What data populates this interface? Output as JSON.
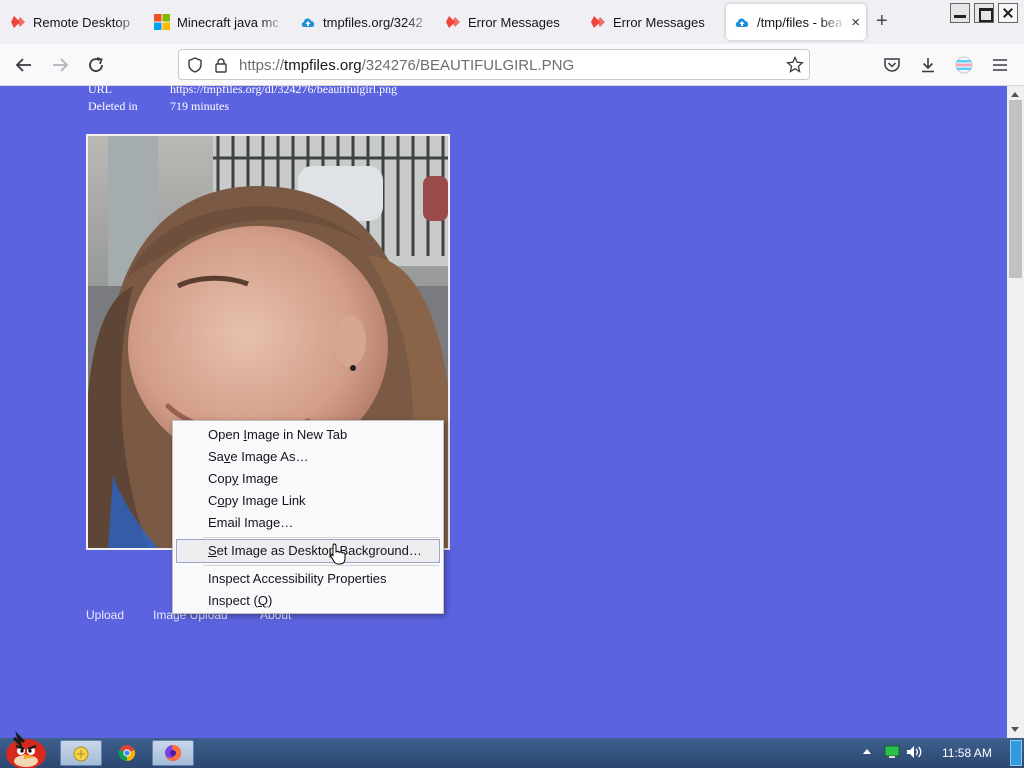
{
  "browser": {
    "tabs": [
      {
        "label": "Remote Desktop",
        "favicon": "anydesk-favicon"
      },
      {
        "label": "Minecraft java mo",
        "favicon": "microsoft-favicon"
      },
      {
        "label": "tmpfiles.org/3242",
        "favicon": "tmpfiles-cloud-favicon"
      },
      {
        "label": "Error Messages",
        "favicon": "anydesk-favicon"
      },
      {
        "label": "Error Messages",
        "favicon": "anydesk-favicon"
      },
      {
        "label": "/tmp/files - bea",
        "favicon": "tmpfiles-cloud-favicon",
        "active": true,
        "close_label": "×"
      }
    ],
    "new_tab_label": "+",
    "url": {
      "scheme": "https://",
      "host": "tmpfiles.org",
      "path": "/324276/BEAUTIFULGIRL.PNG"
    }
  },
  "page": {
    "meta": [
      {
        "label": "URL",
        "value": "https://tmpfiles.org/dl/324276/beautifulgirl.png"
      },
      {
        "label": "Deleted in",
        "value": "719 minutes"
      }
    ],
    "footer_links": [
      "Upload",
      "Image Upload",
      "About"
    ]
  },
  "context_menu": {
    "items": [
      {
        "pre": "Open ",
        "key": "I",
        "post": "mage in New Tab"
      },
      {
        "pre": "Sa",
        "key": "v",
        "post": "e Image As…"
      },
      {
        "pre": "Cop",
        "key": "y",
        "post": " Image"
      },
      {
        "pre": "C",
        "key": "o",
        "post": "py Image Link"
      },
      {
        "pre": "Email Image",
        "key": "",
        "post": "…"
      },
      {
        "pre": "",
        "key": "S",
        "post": "et Image as Desktop Background…"
      },
      {
        "pre": "Inspect Accessibility Properties",
        "key": "",
        "post": ""
      },
      {
        "pre": "Inspect (",
        "key": "Q",
        "post": ")"
      }
    ]
  },
  "taskbar": {
    "clock": "11:58 AM"
  },
  "colors": {
    "page_background": "#5c63e0",
    "taskbar": "#2c4770",
    "anydesk_red": "#ef443b",
    "tmpfiles_blue": "#1a8fd9"
  }
}
